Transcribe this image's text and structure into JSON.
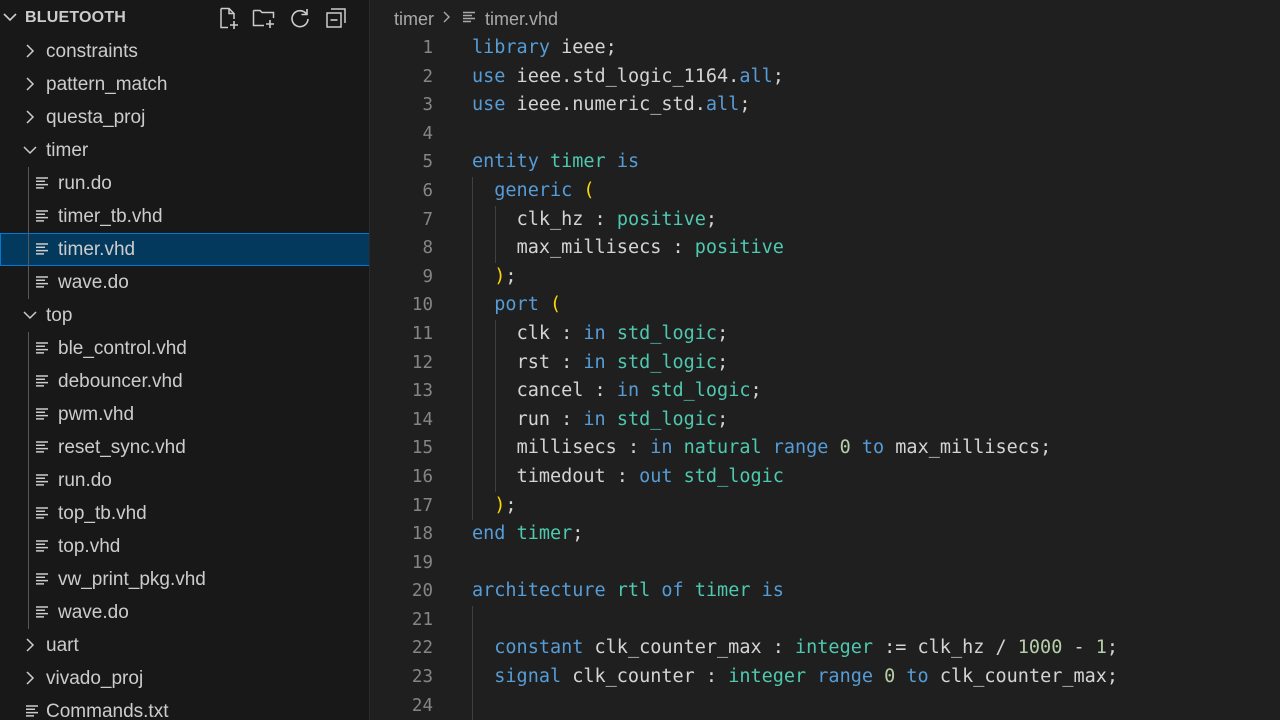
{
  "explorer": {
    "title": "BLUETOOTH",
    "actions": [
      {
        "name": "new-file-icon"
      },
      {
        "name": "new-folder-icon"
      },
      {
        "name": "refresh-icon"
      },
      {
        "name": "collapse-all-icon"
      }
    ],
    "tree": [
      {
        "label": "constraints",
        "type": "folder",
        "level": 0,
        "expanded": false
      },
      {
        "label": "pattern_match",
        "type": "folder",
        "level": 0,
        "expanded": false
      },
      {
        "label": "questa_proj",
        "type": "folder",
        "level": 0,
        "expanded": false
      },
      {
        "label": "timer",
        "type": "folder",
        "level": 0,
        "expanded": true
      },
      {
        "label": "run.do",
        "type": "file",
        "level": 1
      },
      {
        "label": "timer_tb.vhd",
        "type": "file",
        "level": 1
      },
      {
        "label": "timer.vhd",
        "type": "file",
        "level": 1,
        "selected": true
      },
      {
        "label": "wave.do",
        "type": "file",
        "level": 1
      },
      {
        "label": "top",
        "type": "folder",
        "level": 0,
        "expanded": true
      },
      {
        "label": "ble_control.vhd",
        "type": "file",
        "level": 1
      },
      {
        "label": "debouncer.vhd",
        "type": "file",
        "level": 1
      },
      {
        "label": "pwm.vhd",
        "type": "file",
        "level": 1
      },
      {
        "label": "reset_sync.vhd",
        "type": "file",
        "level": 1
      },
      {
        "label": "run.do",
        "type": "file",
        "level": 1
      },
      {
        "label": "top_tb.vhd",
        "type": "file",
        "level": 1
      },
      {
        "label": "top.vhd",
        "type": "file",
        "level": 1
      },
      {
        "label": "vw_print_pkg.vhd",
        "type": "file",
        "level": 1
      },
      {
        "label": "wave.do",
        "type": "file",
        "level": 1
      },
      {
        "label": "uart",
        "type": "folder",
        "level": 0,
        "expanded": false
      },
      {
        "label": "vivado_proj",
        "type": "folder",
        "level": 0,
        "expanded": false
      },
      {
        "label": "Commands.txt",
        "type": "file",
        "level": 0
      }
    ]
  },
  "breadcrumb": {
    "folder": "timer",
    "file": "timer.vhd"
  },
  "editor": {
    "lines": [
      {
        "n": "1",
        "indent": 0,
        "tokens": [
          [
            "kw",
            "library"
          ],
          [
            "tx",
            " ieee;"
          ]
        ]
      },
      {
        "n": "2",
        "indent": 0,
        "tokens": [
          [
            "kw",
            "use"
          ],
          [
            "tx",
            " ieee.std_logic_1164."
          ],
          [
            "kw",
            "all"
          ],
          [
            "tx",
            ";"
          ]
        ]
      },
      {
        "n": "3",
        "indent": 0,
        "tokens": [
          [
            "kw",
            "use"
          ],
          [
            "tx",
            " ieee.numeric_std."
          ],
          [
            "kw",
            "all"
          ],
          [
            "tx",
            ";"
          ]
        ]
      },
      {
        "n": "4",
        "indent": 0,
        "tokens": []
      },
      {
        "n": "5",
        "indent": 0,
        "tokens": [
          [
            "kw",
            "entity"
          ],
          [
            "tx",
            " "
          ],
          [
            "ty",
            "timer"
          ],
          [
            "tx",
            " "
          ],
          [
            "kw",
            "is"
          ]
        ]
      },
      {
        "n": "6",
        "indent": 1,
        "tokens": [
          [
            "kw",
            "generic"
          ],
          [
            "tx",
            " "
          ],
          [
            "br",
            "("
          ]
        ]
      },
      {
        "n": "7",
        "indent": 2,
        "tokens": [
          [
            "tx",
            "clk_hz : "
          ],
          [
            "ty",
            "positive"
          ],
          [
            "tx",
            ";"
          ]
        ]
      },
      {
        "n": "8",
        "indent": 2,
        "tokens": [
          [
            "tx",
            "max_millisecs : "
          ],
          [
            "ty",
            "positive"
          ]
        ]
      },
      {
        "n": "9",
        "indent": 1,
        "tokens": [
          [
            "br",
            ")"
          ],
          [
            "tx",
            ";"
          ]
        ]
      },
      {
        "n": "10",
        "indent": 1,
        "tokens": [
          [
            "kw",
            "port"
          ],
          [
            "tx",
            " "
          ],
          [
            "br",
            "("
          ]
        ]
      },
      {
        "n": "11",
        "indent": 2,
        "tokens": [
          [
            "tx",
            "clk : "
          ],
          [
            "kw",
            "in"
          ],
          [
            "tx",
            " "
          ],
          [
            "ty",
            "std_logic"
          ],
          [
            "tx",
            ";"
          ]
        ]
      },
      {
        "n": "12",
        "indent": 2,
        "tokens": [
          [
            "tx",
            "rst : "
          ],
          [
            "kw",
            "in"
          ],
          [
            "tx",
            " "
          ],
          [
            "ty",
            "std_logic"
          ],
          [
            "tx",
            ";"
          ]
        ]
      },
      {
        "n": "13",
        "indent": 2,
        "tokens": [
          [
            "tx",
            "cancel : "
          ],
          [
            "kw",
            "in"
          ],
          [
            "tx",
            " "
          ],
          [
            "ty",
            "std_logic"
          ],
          [
            "tx",
            ";"
          ]
        ]
      },
      {
        "n": "14",
        "indent": 2,
        "tokens": [
          [
            "tx",
            "run : "
          ],
          [
            "kw",
            "in"
          ],
          [
            "tx",
            " "
          ],
          [
            "ty",
            "std_logic"
          ],
          [
            "tx",
            ";"
          ]
        ]
      },
      {
        "n": "15",
        "indent": 2,
        "tokens": [
          [
            "tx",
            "millisecs : "
          ],
          [
            "kw",
            "in"
          ],
          [
            "tx",
            " "
          ],
          [
            "ty",
            "natural"
          ],
          [
            "tx",
            " "
          ],
          [
            "kw",
            "range"
          ],
          [
            "tx",
            " "
          ],
          [
            "nm",
            "0"
          ],
          [
            "tx",
            " "
          ],
          [
            "kw",
            "to"
          ],
          [
            "tx",
            " max_millisecs;"
          ]
        ]
      },
      {
        "n": "16",
        "indent": 2,
        "tokens": [
          [
            "tx",
            "timedout : "
          ],
          [
            "kw",
            "out"
          ],
          [
            "tx",
            " "
          ],
          [
            "ty",
            "std_logic"
          ]
        ]
      },
      {
        "n": "17",
        "indent": 1,
        "tokens": [
          [
            "br",
            ")"
          ],
          [
            "tx",
            ";"
          ]
        ]
      },
      {
        "n": "18",
        "indent": 0,
        "tokens": [
          [
            "kw",
            "end"
          ],
          [
            "tx",
            " "
          ],
          [
            "ty",
            "timer"
          ],
          [
            "tx",
            ";"
          ]
        ]
      },
      {
        "n": "19",
        "indent": 0,
        "tokens": []
      },
      {
        "n": "20",
        "indent": 0,
        "tokens": [
          [
            "kw",
            "architecture"
          ],
          [
            "tx",
            " "
          ],
          [
            "ty",
            "rtl"
          ],
          [
            "tx",
            " "
          ],
          [
            "kw",
            "of"
          ],
          [
            "tx",
            " "
          ],
          [
            "ty",
            "timer"
          ],
          [
            "tx",
            " "
          ],
          [
            "kw",
            "is"
          ]
        ]
      },
      {
        "n": "21",
        "indent": 0,
        "tokens": []
      },
      {
        "n": "22",
        "indent": 1,
        "tokens": [
          [
            "kw",
            "constant"
          ],
          [
            "tx",
            " clk_counter_max : "
          ],
          [
            "ty",
            "integer"
          ],
          [
            "tx",
            " := clk_hz / "
          ],
          [
            "nm",
            "1000"
          ],
          [
            "tx",
            " - "
          ],
          [
            "nm",
            "1"
          ],
          [
            "tx",
            ";"
          ]
        ]
      },
      {
        "n": "23",
        "indent": 1,
        "tokens": [
          [
            "kw",
            "signal"
          ],
          [
            "tx",
            " clk_counter : "
          ],
          [
            "ty",
            "integer"
          ],
          [
            "tx",
            " "
          ],
          [
            "kw",
            "range"
          ],
          [
            "tx",
            " "
          ],
          [
            "nm",
            "0"
          ],
          [
            "tx",
            " "
          ],
          [
            "kw",
            "to"
          ],
          [
            "tx",
            " clk_counter_max;"
          ]
        ]
      },
      {
        "n": "24",
        "indent": 0,
        "tokens": []
      }
    ]
  }
}
